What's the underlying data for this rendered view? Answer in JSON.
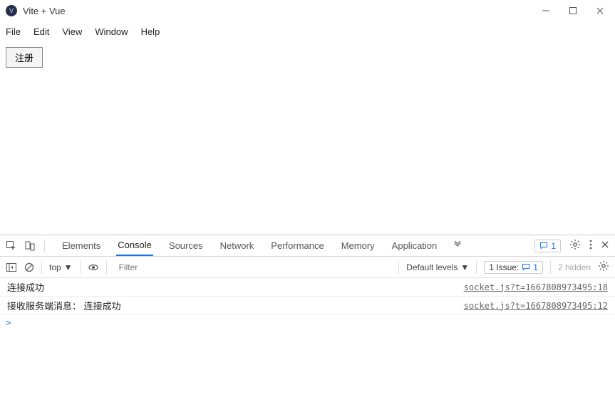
{
  "window": {
    "title": "Vite + Vue"
  },
  "menu": {
    "file": "File",
    "edit": "Edit",
    "view": "View",
    "window": "Window",
    "help": "Help"
  },
  "app": {
    "register_button": "注册"
  },
  "devtools": {
    "tabs": {
      "elements": "Elements",
      "console": "Console",
      "sources": "Sources",
      "network": "Network",
      "performance": "Performance",
      "memory": "Memory",
      "application": "Application"
    },
    "warnings_count": "1",
    "console_toolbar": {
      "context_label": "top",
      "filter_placeholder": "Filter",
      "levels_label": "Default levels",
      "issues_label": "1 Issue:",
      "issues_count": "1",
      "hidden_label": "2 hidden"
    },
    "messages": [
      {
        "text": "连接成功",
        "source": "socket.js?t=1667808973495:18"
      },
      {
        "text": "接收服务端消息： 连接成功",
        "source": "socket.js?t=1667808973495:12"
      }
    ]
  }
}
